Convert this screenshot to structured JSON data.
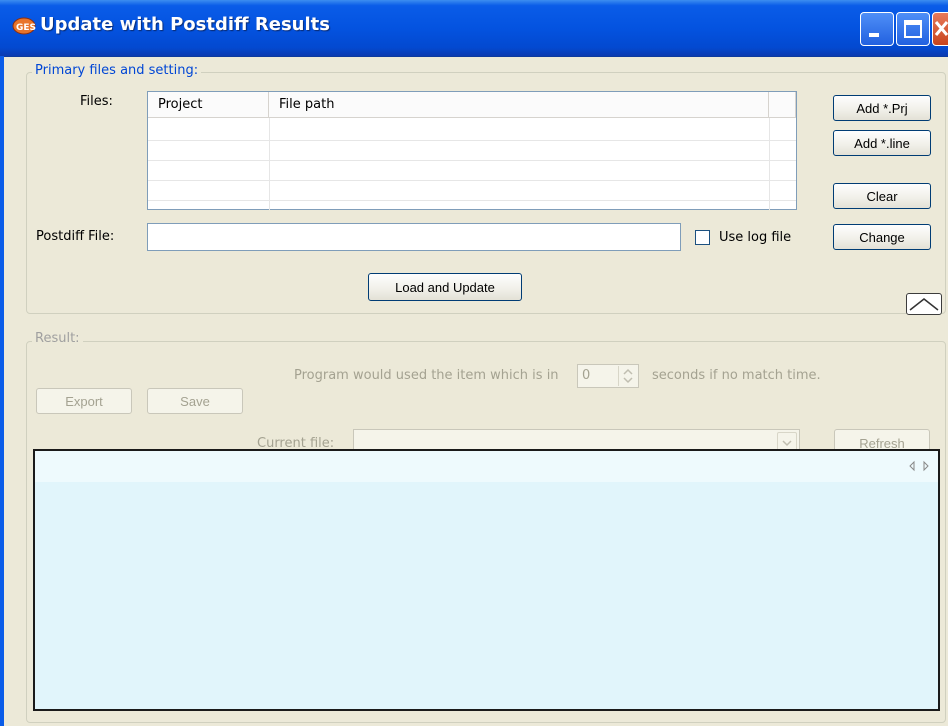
{
  "window": {
    "title": "Update with Postdiff Results",
    "icons": {
      "app": "app-icon",
      "minimize": "minimize-icon",
      "maximize": "maximize-icon",
      "close": "close-icon"
    }
  },
  "primary": {
    "legend": "Primary files and setting:",
    "files_label": "Files:",
    "table": {
      "columns": [
        "Project",
        "File path"
      ]
    },
    "postdiff_label": "Postdiff File:",
    "postdiff_value": "",
    "use_log_label": "Use log file",
    "use_log_checked": false,
    "buttons": {
      "add_prj": "Add *.Prj",
      "add_line": "Add *.line",
      "clear": "Clear",
      "change": "Change",
      "load_update": "Load and Update"
    }
  },
  "result": {
    "legend": "Result:",
    "export": "Export",
    "save": "Save",
    "program_text_before": "Program would used the item which is in",
    "seconds_value": "0",
    "program_text_after": "seconds if no match time.",
    "current_file_label": "Current file:",
    "current_file_value": "",
    "refresh": "Refresh"
  }
}
